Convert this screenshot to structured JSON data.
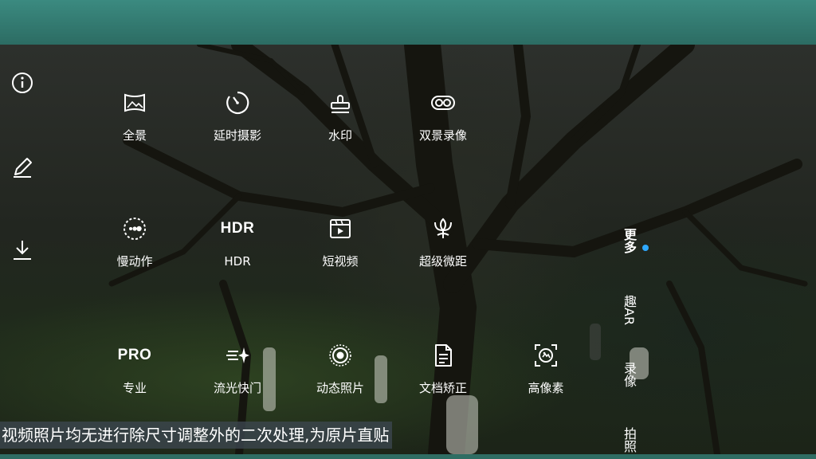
{
  "side_tools": [
    {
      "icon": "info-icon"
    },
    {
      "icon": "edit-pen-icon"
    },
    {
      "icon": "download-icon"
    }
  ],
  "modes": [
    {
      "label": "全景",
      "icon": "panorama-icon"
    },
    {
      "label": "延时摄影",
      "icon": "timelapse-icon"
    },
    {
      "label": "水印",
      "icon": "watermark-stamp-icon"
    },
    {
      "label": "双景录像",
      "icon": "dual-view-icon"
    },
    {
      "label": "慢动作",
      "icon": "slow-motion-icon"
    },
    {
      "label": "HDR",
      "icon": "hdr-icon",
      "icon_text": "HDR"
    },
    {
      "label": "短视频",
      "icon": "short-video-icon"
    },
    {
      "label": "超级微距",
      "icon": "super-macro-icon"
    },
    {
      "label": "专业",
      "icon": "pro-icon",
      "icon_text": "PRO"
    },
    {
      "label": "流光快门",
      "icon": "light-painting-icon"
    },
    {
      "label": "动态照片",
      "icon": "moving-picture-icon"
    },
    {
      "label": "文档矫正",
      "icon": "document-correction-icon"
    },
    {
      "label": "高像素",
      "icon": "high-resolution-icon"
    }
  ],
  "tabs": [
    {
      "label": "更多",
      "active": true
    },
    {
      "label": "趣AR",
      "active": false
    },
    {
      "label": "录像",
      "active": false
    },
    {
      "label": "拍照",
      "active": false
    }
  ],
  "colors": {
    "active_dot": "#2ea8ff",
    "frame": "#2f6d63"
  },
  "caption": "视频照片均无进行除尺寸调整外的二次处理,为原片直贴"
}
